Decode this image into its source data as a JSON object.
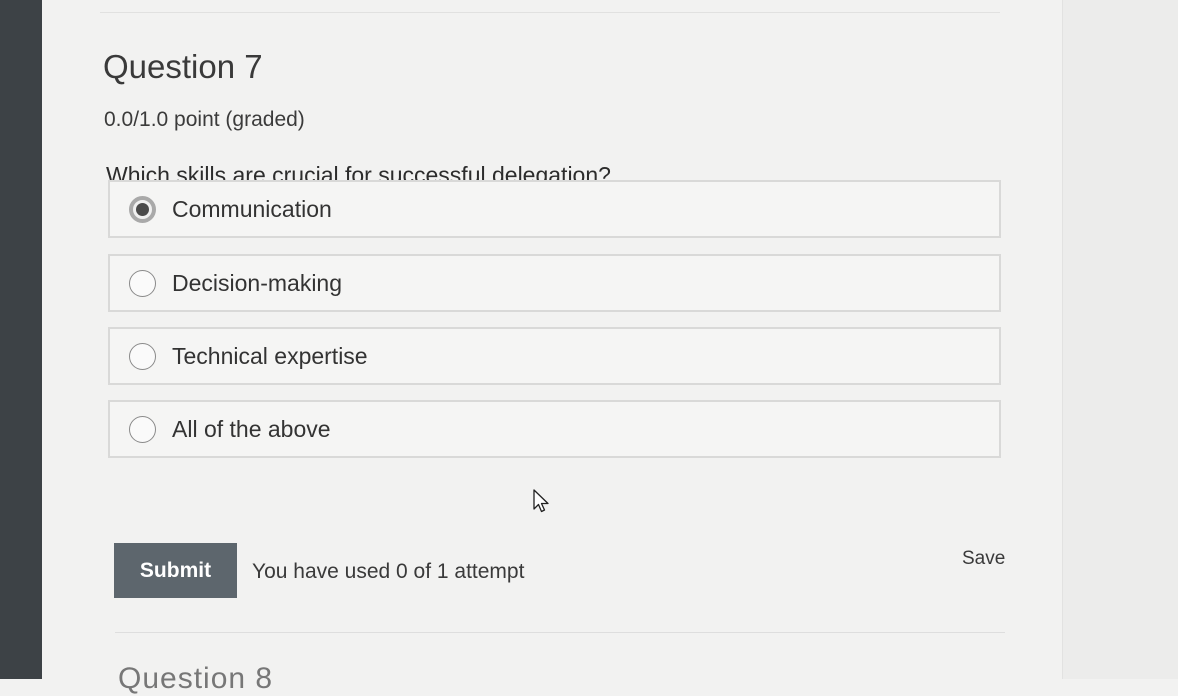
{
  "question": {
    "title": "Question 7",
    "points": "0.0/1.0 point (graded)",
    "prompt": "Which skills are crucial for successful delegation?"
  },
  "options": [
    {
      "label": "Communication",
      "selected": true
    },
    {
      "label": "Decision-making",
      "selected": false
    },
    {
      "label": "Technical expertise",
      "selected": false
    },
    {
      "label": "All of the above",
      "selected": false
    }
  ],
  "actions": {
    "submit_label": "Submit",
    "attempts_text": "You have used 0 of 1 attempt",
    "save_label": "Save"
  },
  "next_question_peek": "Question 8",
  "colors": {
    "submit_bg": "#5d666d",
    "page_bg": "#f2f2f1",
    "bezel": "#3d4246"
  }
}
